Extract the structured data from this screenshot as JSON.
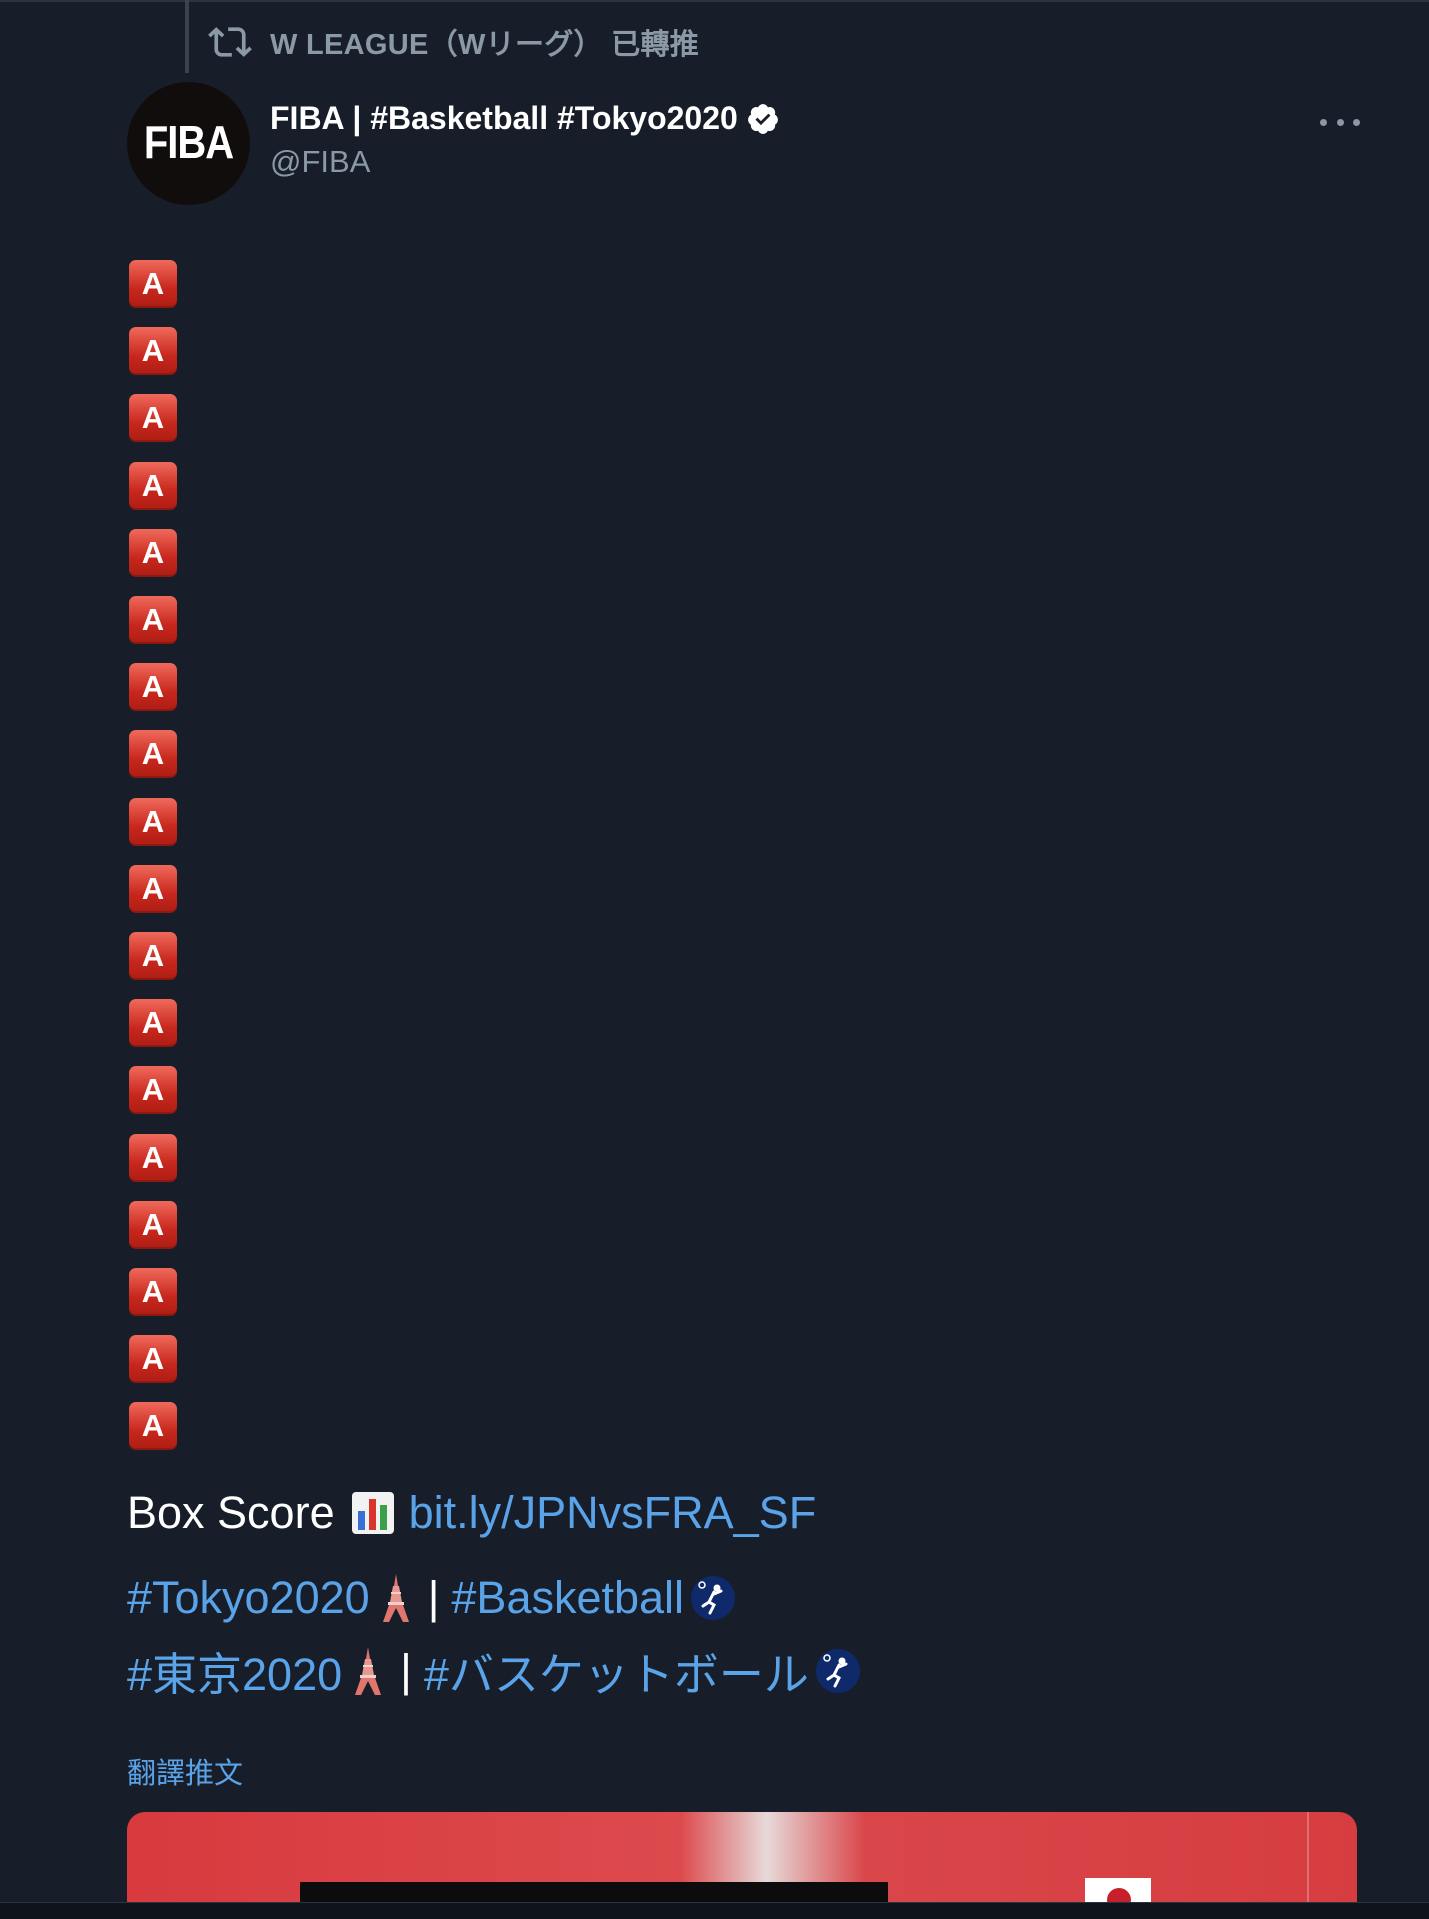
{
  "retweet": {
    "text": "W LEAGUE（Wリーグ） 已轉推",
    "icon": "retweet-icon"
  },
  "author": {
    "avatar_text": "FIBA",
    "display_name": "FIBA | #Basketball #Tokyo2020",
    "handle": "@FIBA",
    "verified": true
  },
  "menu": {
    "icon": "more-icon"
  },
  "tweet": {
    "a_emoji_letter": "A",
    "a_emoji_count": 18,
    "box_score_label": "Box Score",
    "box_score_link": "bit.ly/JPNvsFRA_SF",
    "tags_line1": {
      "tag1": "#Tokyo2020",
      "separator": "|",
      "tag2": "#Basketball"
    },
    "tags_line2": {
      "tag1": "#東京2020",
      "separator": "|",
      "tag2": "#バスケットボール"
    },
    "translate": "翻譯推文"
  },
  "colors": {
    "background": "#171e29",
    "link": "#5aa3e8",
    "muted": "#8b98a5",
    "emoji_red": "#d63a2c"
  }
}
